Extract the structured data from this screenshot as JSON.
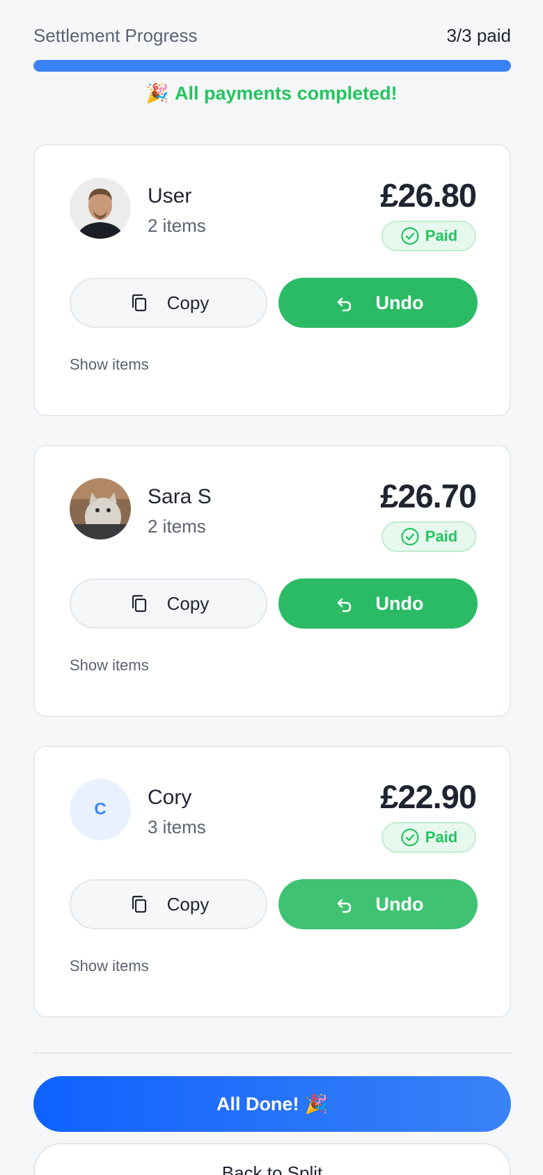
{
  "progress": {
    "title": "Settlement Progress",
    "count": "3/3 paid",
    "fraction": 1.0,
    "message": "All payments completed!",
    "emoji": "🎉"
  },
  "people": [
    {
      "name": "User",
      "items": "2 items",
      "amount": "£26.80",
      "status": "Paid",
      "avatar": "photo-man"
    },
    {
      "name": "Sara S",
      "items": "2 items",
      "amount": "£26.70",
      "status": "Paid",
      "avatar": "photo-cat"
    },
    {
      "name": "Cory",
      "items": "3 items",
      "amount": "£22.90",
      "status": "Paid",
      "avatar_initial": "C"
    }
  ],
  "buttons": {
    "copy": "Copy",
    "undo": "Undo",
    "show_items": "Show items",
    "all_done": "All Done!",
    "all_done_emoji": "🎉",
    "back": "Back to Split"
  },
  "colors": {
    "accent": "#3b82f6",
    "success": "#22c55e",
    "undo_bg": "#2bbb65"
  }
}
